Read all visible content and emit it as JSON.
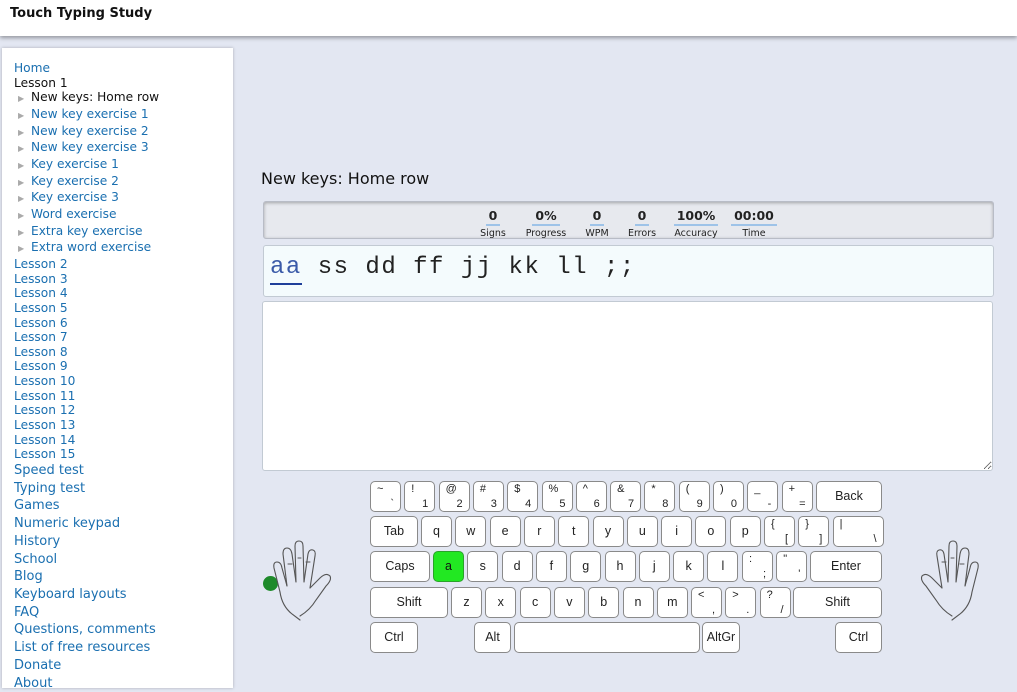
{
  "site": {
    "title": "Touch Typing Study"
  },
  "sidebar": {
    "home": "Home",
    "lesson1": "Lesson 1",
    "sub_items": [
      "New keys: Home row",
      "New key exercise 1",
      "New key exercise 2",
      "New key exercise 3",
      "Key exercise 1",
      "Key exercise 2",
      "Key exercise 3",
      "Word exercise",
      "Extra key exercise",
      "Extra word exercise"
    ],
    "lessons": [
      "Lesson 2",
      "Lesson 3",
      "Lesson 4",
      "Lesson 5",
      "Lesson 6",
      "Lesson 7",
      "Lesson 8",
      "Lesson 9",
      "Lesson 10",
      "Lesson 11",
      "Lesson 12",
      "Lesson 13",
      "Lesson 14",
      "Lesson 15"
    ],
    "links": [
      "Speed test",
      "Typing test",
      "Games",
      "Numeric keypad",
      "History",
      "School",
      "Blog",
      "Keyboard layouts",
      "FAQ",
      "Questions, comments",
      "List of free resources",
      "Donate",
      "About"
    ]
  },
  "exercise": {
    "title": "New keys: Home row",
    "current_group": "aa",
    "rest_text": " ss dd ff jj kk ll ;;"
  },
  "stats": [
    {
      "value": "0",
      "label": "Signs"
    },
    {
      "value": "0%",
      "label": "Progress"
    },
    {
      "value": "0",
      "label": "WPM"
    },
    {
      "value": "0",
      "label": "Errors"
    },
    {
      "value": "100%",
      "label": "Accuracy"
    },
    {
      "value": "00:00",
      "label": "Time"
    }
  ],
  "keyboard": {
    "row1": [
      [
        "~",
        "`"
      ],
      [
        "!",
        "1"
      ],
      [
        "@",
        "2"
      ],
      [
        "#",
        "3"
      ],
      [
        "$",
        "4"
      ],
      [
        "%",
        "5"
      ],
      [
        "^",
        "6"
      ],
      [
        "&",
        "7"
      ],
      [
        "*",
        "8"
      ],
      [
        "(",
        "9"
      ],
      [
        ")",
        "0"
      ],
      [
        "_",
        "-"
      ],
      [
        "+",
        "="
      ]
    ],
    "back": "Back",
    "tab": "Tab",
    "row2": [
      "q",
      "w",
      "e",
      "r",
      "t",
      "y",
      "u",
      "i",
      "o",
      "p"
    ],
    "row2_punct": [
      [
        "{",
        "["
      ],
      [
        "}",
        "]"
      ],
      [
        "|",
        "\\"
      ]
    ],
    "caps": "Caps",
    "row3": [
      "a",
      "s",
      "d",
      "f",
      "g",
      "h",
      "j",
      "k",
      "l"
    ],
    "row3_punct": [
      [
        ":",
        ";"
      ],
      [
        "\"",
        "'"
      ]
    ],
    "enter": "Enter",
    "shift_left": "Shift",
    "row4": [
      "z",
      "x",
      "c",
      "v",
      "b",
      "n",
      "m"
    ],
    "row4_punct": [
      [
        "<",
        ","
      ],
      [
        ">",
        "."
      ],
      [
        "?",
        "/"
      ]
    ],
    "shift_right": "Shift",
    "ctrl_left": "Ctrl",
    "alt": "Alt",
    "altgr": "AltGr",
    "ctrl_right": "Ctrl",
    "highlight_key": "a",
    "highlight_color": "#22e822"
  }
}
